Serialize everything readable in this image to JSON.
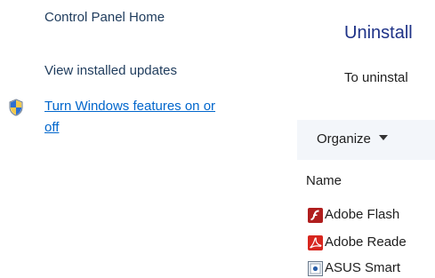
{
  "sidebar": {
    "home_label": "Control Panel Home",
    "updates_label": "View installed updates",
    "features_label_line1": "Turn Windows features on or",
    "features_label_line2": "off"
  },
  "main": {
    "title": "Uninstall",
    "subtitle": "To uninstal"
  },
  "toolbar": {
    "organize_label": "Organize"
  },
  "table": {
    "column_name": "Name",
    "rows": [
      {
        "label": "Adobe Flash",
        "icon": "flash-icon"
      },
      {
        "label": "Adobe Reade",
        "icon": "pdf-icon"
      },
      {
        "label": "ASUS Smart",
        "icon": "asus-icon"
      }
    ]
  },
  "colors": {
    "link": "#0066cc",
    "title": "#1e3287",
    "toolbar_bg": "#f3f6fa"
  }
}
